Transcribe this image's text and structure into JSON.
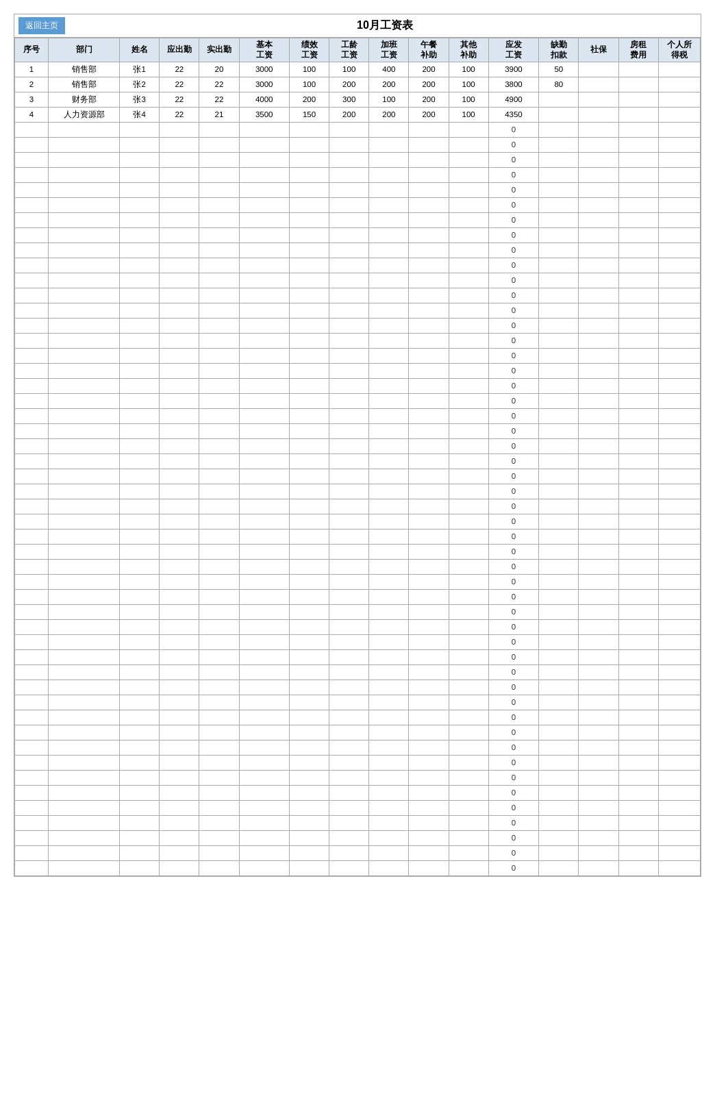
{
  "title": "10月工资表",
  "backBtn": "返回主页",
  "headers": {
    "seq": "序号",
    "dept": "部门",
    "name": "姓名",
    "shouldWork": "应出勤",
    "actualWork": "实出勤",
    "baseWage": [
      "基本",
      "工资"
    ],
    "perfWage": [
      "绩效",
      "工资"
    ],
    "ageWage": [
      "工龄",
      "工资"
    ],
    "otWage": [
      "加班",
      "工资"
    ],
    "mealSub": [
      "午餐",
      "补助"
    ],
    "otherSub": [
      "其他",
      "补助"
    ],
    "shouldPay": [
      "应发",
      "工资"
    ],
    "deduct": [
      "缺勤",
      "扣款"
    ],
    "social": "社保",
    "house": [
      "房租",
      "费用"
    ],
    "tax": [
      "个人所",
      "得税"
    ]
  },
  "rows": [
    {
      "seq": "1",
      "dept": "销售部",
      "name": "张1",
      "shouldWork": "22",
      "actualWork": "20",
      "base": "3000",
      "perf": "100",
      "age": "100",
      "ot": "400",
      "meal": "200",
      "other": "100",
      "should": "3900",
      "deduct": "50",
      "social": "",
      "house": "",
      "tax": ""
    },
    {
      "seq": "2",
      "dept": "销售部",
      "name": "张2",
      "shouldWork": "22",
      "actualWork": "22",
      "base": "3000",
      "perf": "100",
      "age": "200",
      "ot": "200",
      "meal": "200",
      "other": "100",
      "should": "3800",
      "deduct": "80",
      "social": "",
      "house": "",
      "tax": ""
    },
    {
      "seq": "3",
      "dept": "财务部",
      "name": "张3",
      "shouldWork": "22",
      "actualWork": "22",
      "base": "4000",
      "perf": "200",
      "age": "300",
      "ot": "100",
      "meal": "200",
      "other": "100",
      "should": "4900",
      "deduct": "",
      "social": "",
      "house": "",
      "tax": ""
    },
    {
      "seq": "4",
      "dept": "人力资源部",
      "name": "张4",
      "shouldWork": "22",
      "actualWork": "21",
      "base": "3500",
      "perf": "150",
      "age": "200",
      "ot": "200",
      "meal": "200",
      "other": "100",
      "should": "4350",
      "deduct": "",
      "social": "",
      "house": "",
      "tax": ""
    }
  ],
  "emptyRowCount": 50,
  "zeroValue": "0"
}
